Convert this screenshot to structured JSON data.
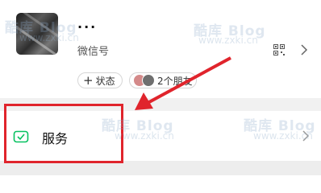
{
  "profile": {
    "nickname": "...",
    "wechat_id_label": "微信号",
    "status_button": "状态",
    "friends_label": "2个朋友"
  },
  "service": {
    "label": "服务"
  },
  "watermarks": [
    {
      "text": "酷库 Blog"
    },
    {
      "text": "www.zxki.cn"
    },
    {
      "text": "酷库 Blog"
    },
    {
      "text": "www.zxki.cn"
    },
    {
      "text": "酷库 Blog"
    },
    {
      "text": "www.zxki.cn"
    },
    {
      "text": "酷库 Blog"
    },
    {
      "text": "www.zxki.cn"
    }
  ],
  "colors": {
    "accent_green": "#07c160",
    "annotation_red": "#e0242c"
  },
  "icons": {
    "qr": "qr-code-icon",
    "chevron": "chevron-right-icon",
    "plus": "plus-icon",
    "service": "wechat-pay-icon"
  }
}
